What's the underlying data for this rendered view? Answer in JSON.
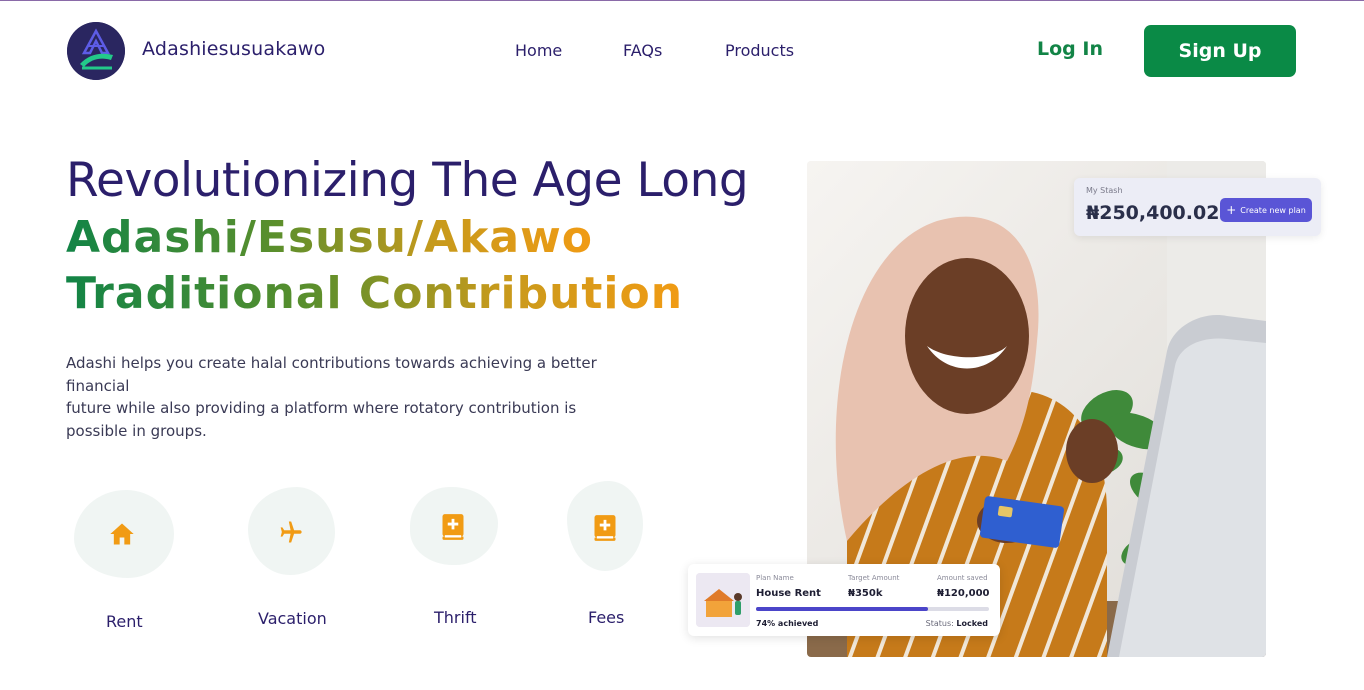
{
  "colors": {
    "brand_navy": "#2b1f6b",
    "brand_green": "#0a8a46",
    "accent_orange": "#f19b14",
    "blob_bg": "#f0f5f3"
  },
  "header": {
    "brand_name": "Adashiesusuakawo",
    "logo_icon": "logo-icon",
    "nav": [
      {
        "label": "Home"
      },
      {
        "label": "FAQs"
      },
      {
        "label": "Products"
      }
    ],
    "login_label": "Log In",
    "signup_label": "Sign Up"
  },
  "hero": {
    "title_line1": "Revolutionizing The Age Long",
    "title_line2": "Adashi/Esusu/Akawo",
    "title_line3": "Traditional Contribution",
    "description_lines": [
      "Adashi helps you create halal contributions towards achieving a better financial",
      "future while also providing a platform where rotatory contribution is",
      "possible in groups."
    ]
  },
  "categories": [
    {
      "label": "Rent",
      "icon": "house-icon"
    },
    {
      "label": "Vacation",
      "icon": "airplane-icon"
    },
    {
      "label": "Thrift",
      "icon": "book-plus-icon"
    },
    {
      "label": "Fees",
      "icon": "book-plus-icon"
    }
  ],
  "stash_card": {
    "label": "My Stash",
    "amount": "₦250,400.02",
    "button_label": "Create new plan",
    "button_icon": "plus-icon"
  },
  "plan_card": {
    "col1_header": "Plan Name",
    "col1_value": "House Rent",
    "col2_header": "Target Amount",
    "col2_value": "₦350k",
    "col3_header": "Amount saved",
    "col3_value": "₦120,000",
    "progress_percent": 74,
    "achieved_text": "74% achieved",
    "status_label": "Status:",
    "status_value": "Locked"
  }
}
